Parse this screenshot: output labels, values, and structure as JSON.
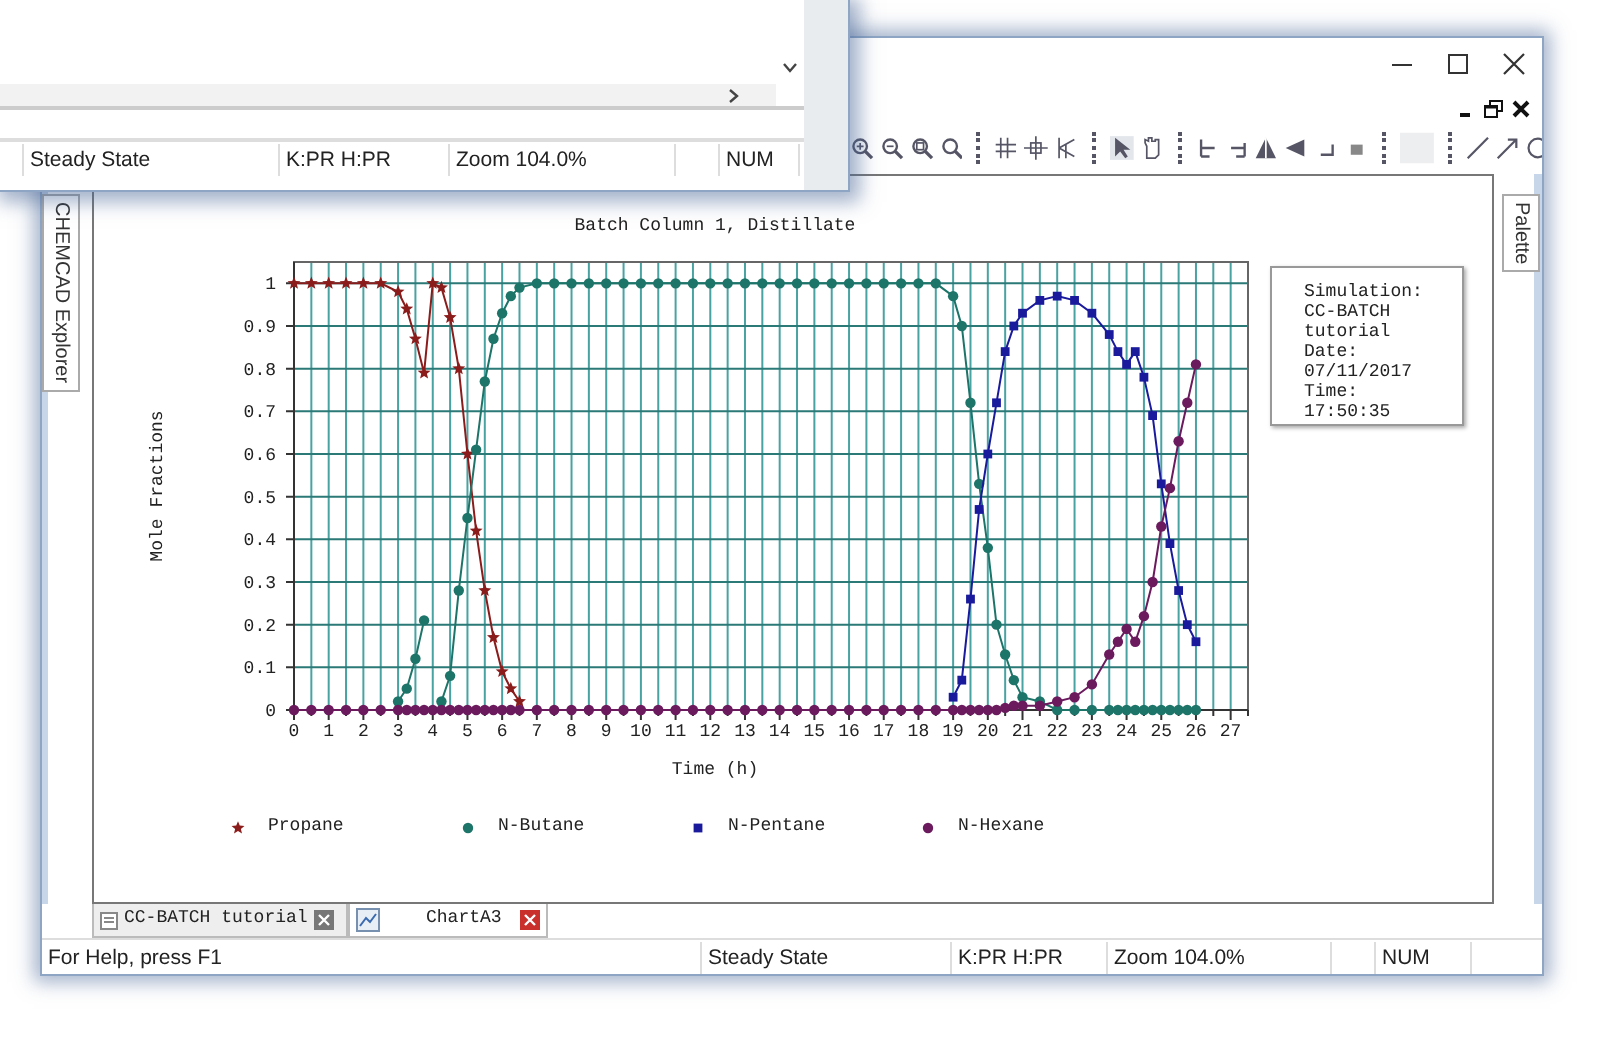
{
  "back_window": {
    "status_bar": [
      "Steady State",
      "K:PR H:PR",
      "Zoom 104.0%",
      "NUM"
    ]
  },
  "explorer_tab": {
    "label": "CHEMCAD Explorer"
  },
  "palette_tab": {
    "label": "Palette"
  },
  "chart": {
    "chart_data": {
      "type": "line",
      "title": "Batch Column 1, Distillate",
      "xlabel": "Time (h)",
      "ylabel": "Mole Fractions",
      "grid": true,
      "x": [
        0,
        0.5,
        1,
        1.5,
        2,
        2.5,
        3,
        3.25,
        3.5,
        3.75,
        4,
        4.25,
        4.5,
        4.75,
        5,
        5.25,
        5.5,
        5.75,
        6,
        6.25,
        6.5,
        7,
        7.5,
        8,
        8.5,
        9,
        9.5,
        10,
        10.5,
        11,
        11.5,
        12,
        12.5,
        13,
        13.5,
        14,
        14.5,
        15,
        15.5,
        16,
        16.5,
        17,
        17.5,
        18,
        18.5,
        19,
        19.25,
        19.5,
        19.75,
        20,
        20.25,
        20.5,
        20.75,
        21,
        21.5,
        22,
        22.5,
        23,
        23.5,
        23.75,
        24,
        24.25,
        24.5,
        24.75,
        25,
        25.25,
        25.5,
        25.75,
        26
      ],
      "series": [
        {
          "name": "Propane",
          "color": "#8b1c1c",
          "marker": "star",
          "values": [
            1,
            1,
            1,
            1,
            1,
            1,
            0.98,
            0.94,
            0.87,
            0.79,
            1,
            0.99,
            0.92,
            0.8,
            0.6,
            0.42,
            0.28,
            0.17,
            0.09,
            0.05,
            0.02,
            null,
            null,
            null,
            null,
            null,
            null,
            null,
            null,
            null,
            null,
            null,
            null,
            null,
            null,
            null,
            null,
            null,
            null,
            null,
            null,
            null,
            null,
            null,
            null,
            null,
            null,
            null,
            null,
            null,
            null,
            null,
            null,
            null,
            null,
            null,
            null,
            null,
            null,
            null,
            null,
            null,
            null,
            null,
            null,
            null,
            null,
            null,
            null
          ]
        },
        {
          "name": "N-Butane",
          "color": "#1d7468",
          "marker": "circle",
          "values": [
            null,
            null,
            null,
            null,
            null,
            null,
            0.02,
            0.05,
            0.12,
            0.21,
            null,
            0.02,
            0.08,
            0.28,
            0.45,
            0.61,
            0.77,
            0.87,
            0.93,
            0.97,
            0.99,
            1,
            1,
            1,
            1,
            1,
            1,
            1,
            1,
            1,
            1,
            1,
            1,
            1,
            1,
            1,
            1,
            1,
            1,
            1,
            1,
            1,
            1,
            1,
            1,
            0.97,
            0.9,
            0.72,
            0.53,
            0.38,
            0.2,
            0.13,
            0.07,
            0.03,
            0.02,
            0,
            0,
            0,
            0,
            0,
            0,
            0,
            0,
            0,
            0,
            0,
            0,
            0,
            0
          ]
        },
        {
          "name": "N-Pentane",
          "color": "#1a1a9c",
          "marker": "square",
          "values": [
            null,
            null,
            null,
            null,
            null,
            null,
            null,
            null,
            null,
            null,
            null,
            null,
            null,
            null,
            null,
            null,
            null,
            null,
            null,
            null,
            null,
            null,
            null,
            null,
            null,
            null,
            null,
            null,
            null,
            null,
            null,
            null,
            null,
            null,
            null,
            null,
            null,
            null,
            null,
            null,
            null,
            null,
            null,
            null,
            null,
            0.03,
            0.07,
            0.26,
            0.47,
            0.6,
            0.72,
            0.84,
            0.9,
            0.93,
            0.96,
            0.97,
            0.96,
            0.93,
            0.88,
            0.84,
            0.81,
            0.84,
            0.78,
            0.69,
            0.53,
            0.39,
            0.28,
            0.2,
            0.16
          ]
        },
        {
          "name": "N-Hexane",
          "color": "#6b1a5e",
          "marker": "circle",
          "values": [
            0,
            0,
            0,
            0,
            0,
            0,
            0,
            0,
            0,
            0,
            0,
            0,
            0,
            0,
            0,
            0,
            0,
            0,
            0,
            0,
            0,
            0,
            0,
            0,
            0,
            0,
            0,
            0,
            0,
            0,
            0,
            0,
            0,
            0,
            0,
            0,
            0,
            0,
            0,
            0,
            0,
            0,
            0,
            0,
            0,
            0,
            0,
            0,
            0,
            0,
            0,
            0.005,
            0.01,
            0.01,
            0.01,
            0.02,
            0.03,
            0.06,
            0.13,
            0.16,
            0.19,
            0.16,
            0.22,
            0.3,
            0.43,
            0.52,
            0.63,
            0.72,
            0.81
          ]
        }
      ],
      "xlim": [
        0,
        27.5
      ],
      "ylim": [
        0,
        1.05
      ],
      "xticks": [
        0,
        1,
        2,
        3,
        4,
        5,
        6,
        7,
        8,
        9,
        10,
        11,
        12,
        13,
        14,
        15,
        16,
        17,
        18,
        19,
        20,
        21,
        22,
        23,
        24,
        25,
        26,
        27
      ],
      "yticks": [
        0,
        0.1,
        0.2,
        0.3,
        0.4,
        0.5,
        0.6,
        0.7,
        0.8,
        0.9,
        1
      ]
    }
  },
  "info_box": {
    "lines": [
      "Simulation:",
      "CC-BATCH",
      "tutorial",
      "Date:",
      "07/11/2017",
      "Time:",
      "17:50:35"
    ]
  },
  "doc_tabs": [
    {
      "label": "CC-BATCH tutorial",
      "selected": false
    },
    {
      "label": "ChartA3",
      "selected": true
    }
  ],
  "status_bar": [
    "For Help, press F1",
    "Steady State",
    "K:PR H:PR",
    "Zoom 104.0%",
    "NUM"
  ]
}
